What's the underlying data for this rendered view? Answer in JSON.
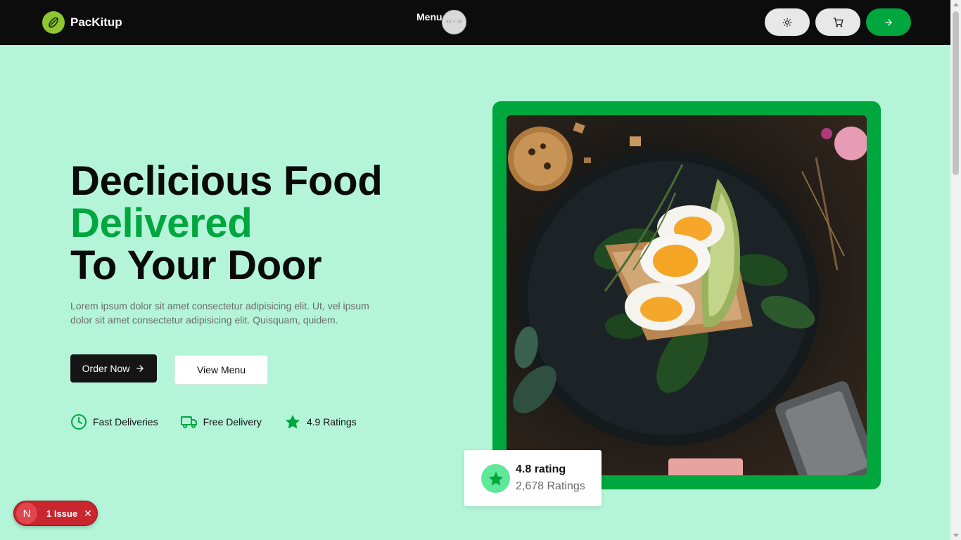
{
  "nav": {
    "brand": "PacKitup",
    "menu_label": "Menu",
    "avatar_placeholder": "40 × 40",
    "theme_icon": "sun-icon",
    "cart_icon": "cart-icon",
    "go_icon": "arrow-right-icon"
  },
  "hero": {
    "line1": "Declicious Food",
    "line2": "Delivered",
    "line3": "To Your Door",
    "description": "Lorem ipsum dolor sit amet consectetur adipisicing elit. Ut, vel ipsum dolor sit amet consectetur adipisicing elit. Quisquam, quidem.",
    "order_label": "Order Now",
    "menu_label": "View Menu",
    "features": [
      {
        "icon": "clock-icon",
        "label": "Fast Deliveries"
      },
      {
        "icon": "truck-icon",
        "label": "Free Delivery"
      },
      {
        "icon": "star-icon",
        "label": "4.9 Ratings"
      }
    ]
  },
  "rating_card": {
    "title": "4.8 rating",
    "count": "2,678 Ratings",
    "icon": "star-icon"
  },
  "issue_badge": {
    "letter": "N",
    "label": "1 Issue",
    "close": "✕"
  },
  "colors": {
    "accent": "#00a63e",
    "background": "#b4f5d9",
    "nav": "#0c0c0c"
  }
}
